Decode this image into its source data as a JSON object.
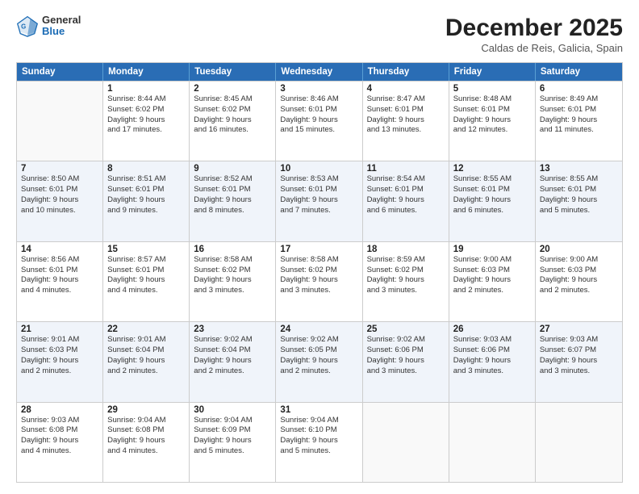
{
  "header": {
    "logo": {
      "line1": "General",
      "line2": "Blue"
    },
    "title": "December 2025",
    "subtitle": "Caldas de Reis, Galicia, Spain"
  },
  "weekdays": [
    "Sunday",
    "Monday",
    "Tuesday",
    "Wednesday",
    "Thursday",
    "Friday",
    "Saturday"
  ],
  "weeks": [
    [
      {
        "day": "",
        "info": ""
      },
      {
        "day": "1",
        "info": "Sunrise: 8:44 AM\nSunset: 6:02 PM\nDaylight: 9 hours\nand 17 minutes."
      },
      {
        "day": "2",
        "info": "Sunrise: 8:45 AM\nSunset: 6:02 PM\nDaylight: 9 hours\nand 16 minutes."
      },
      {
        "day": "3",
        "info": "Sunrise: 8:46 AM\nSunset: 6:01 PM\nDaylight: 9 hours\nand 15 minutes."
      },
      {
        "day": "4",
        "info": "Sunrise: 8:47 AM\nSunset: 6:01 PM\nDaylight: 9 hours\nand 13 minutes."
      },
      {
        "day": "5",
        "info": "Sunrise: 8:48 AM\nSunset: 6:01 PM\nDaylight: 9 hours\nand 12 minutes."
      },
      {
        "day": "6",
        "info": "Sunrise: 8:49 AM\nSunset: 6:01 PM\nDaylight: 9 hours\nand 11 minutes."
      }
    ],
    [
      {
        "day": "7",
        "info": "Sunrise: 8:50 AM\nSunset: 6:01 PM\nDaylight: 9 hours\nand 10 minutes."
      },
      {
        "day": "8",
        "info": "Sunrise: 8:51 AM\nSunset: 6:01 PM\nDaylight: 9 hours\nand 9 minutes."
      },
      {
        "day": "9",
        "info": "Sunrise: 8:52 AM\nSunset: 6:01 PM\nDaylight: 9 hours\nand 8 minutes."
      },
      {
        "day": "10",
        "info": "Sunrise: 8:53 AM\nSunset: 6:01 PM\nDaylight: 9 hours\nand 7 minutes."
      },
      {
        "day": "11",
        "info": "Sunrise: 8:54 AM\nSunset: 6:01 PM\nDaylight: 9 hours\nand 6 minutes."
      },
      {
        "day": "12",
        "info": "Sunrise: 8:55 AM\nSunset: 6:01 PM\nDaylight: 9 hours\nand 6 minutes."
      },
      {
        "day": "13",
        "info": "Sunrise: 8:55 AM\nSunset: 6:01 PM\nDaylight: 9 hours\nand 5 minutes."
      }
    ],
    [
      {
        "day": "14",
        "info": "Sunrise: 8:56 AM\nSunset: 6:01 PM\nDaylight: 9 hours\nand 4 minutes."
      },
      {
        "day": "15",
        "info": "Sunrise: 8:57 AM\nSunset: 6:01 PM\nDaylight: 9 hours\nand 4 minutes."
      },
      {
        "day": "16",
        "info": "Sunrise: 8:58 AM\nSunset: 6:02 PM\nDaylight: 9 hours\nand 3 minutes."
      },
      {
        "day": "17",
        "info": "Sunrise: 8:58 AM\nSunset: 6:02 PM\nDaylight: 9 hours\nand 3 minutes."
      },
      {
        "day": "18",
        "info": "Sunrise: 8:59 AM\nSunset: 6:02 PM\nDaylight: 9 hours\nand 3 minutes."
      },
      {
        "day": "19",
        "info": "Sunrise: 9:00 AM\nSunset: 6:03 PM\nDaylight: 9 hours\nand 2 minutes."
      },
      {
        "day": "20",
        "info": "Sunrise: 9:00 AM\nSunset: 6:03 PM\nDaylight: 9 hours\nand 2 minutes."
      }
    ],
    [
      {
        "day": "21",
        "info": "Sunrise: 9:01 AM\nSunset: 6:03 PM\nDaylight: 9 hours\nand 2 minutes."
      },
      {
        "day": "22",
        "info": "Sunrise: 9:01 AM\nSunset: 6:04 PM\nDaylight: 9 hours\nand 2 minutes."
      },
      {
        "day": "23",
        "info": "Sunrise: 9:02 AM\nSunset: 6:04 PM\nDaylight: 9 hours\nand 2 minutes."
      },
      {
        "day": "24",
        "info": "Sunrise: 9:02 AM\nSunset: 6:05 PM\nDaylight: 9 hours\nand 2 minutes."
      },
      {
        "day": "25",
        "info": "Sunrise: 9:02 AM\nSunset: 6:06 PM\nDaylight: 9 hours\nand 3 minutes."
      },
      {
        "day": "26",
        "info": "Sunrise: 9:03 AM\nSunset: 6:06 PM\nDaylight: 9 hours\nand 3 minutes."
      },
      {
        "day": "27",
        "info": "Sunrise: 9:03 AM\nSunset: 6:07 PM\nDaylight: 9 hours\nand 3 minutes."
      }
    ],
    [
      {
        "day": "28",
        "info": "Sunrise: 9:03 AM\nSunset: 6:08 PM\nDaylight: 9 hours\nand 4 minutes."
      },
      {
        "day": "29",
        "info": "Sunrise: 9:04 AM\nSunset: 6:08 PM\nDaylight: 9 hours\nand 4 minutes."
      },
      {
        "day": "30",
        "info": "Sunrise: 9:04 AM\nSunset: 6:09 PM\nDaylight: 9 hours\nand 5 minutes."
      },
      {
        "day": "31",
        "info": "Sunrise: 9:04 AM\nSunset: 6:10 PM\nDaylight: 9 hours\nand 5 minutes."
      },
      {
        "day": "",
        "info": ""
      },
      {
        "day": "",
        "info": ""
      },
      {
        "day": "",
        "info": ""
      }
    ]
  ]
}
